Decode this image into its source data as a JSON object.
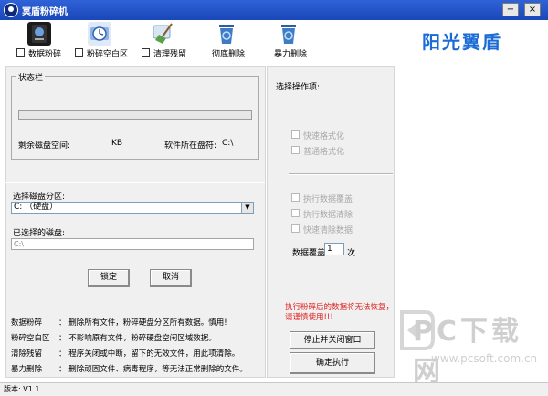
{
  "window": {
    "title": "冥盾粉碎机",
    "minimize": "−",
    "close": "×"
  },
  "toolbar": {
    "items": [
      {
        "label": "数据粉碎",
        "icon": "disk-shredder-icon",
        "color": "#1b1b1b"
      },
      {
        "label": "粉碎空白区",
        "icon": "clock-disk-icon",
        "color": "#4a7fd0"
      },
      {
        "label": "清理残留",
        "icon": "broom-icon",
        "color": "#5aa04a"
      },
      {
        "label": "彻底删除",
        "icon": "recycle-bin-icon",
        "color": "#3f7cc4"
      },
      {
        "label": "暴力删除",
        "icon": "recycle-bin-icon",
        "color": "#3f7cc4"
      }
    ],
    "brand": "阳光翼盾"
  },
  "status": {
    "legend": "状态栏",
    "free_space_label": "剩余磁盘空间:",
    "free_space_unit": "KB",
    "drive_label": "软件所在盘符:",
    "drive_value": "C:\\",
    "progress": 0
  },
  "drive": {
    "select_label": "选择磁盘分区:",
    "selected_option": "C: （硬盘）",
    "chosen_label": "已选择的磁盘:",
    "chosen_value": "C:\\"
  },
  "buttons": {
    "lock": "锁定",
    "cancel": "取消",
    "stop": "停止并关闭窗口",
    "execute": "确定执行"
  },
  "descriptions": [
    {
      "name": "数据粉碎",
      "text": "删除所有文件，粉碎硬盘分区所有数据。慎用!"
    },
    {
      "name": "粉碎空白区",
      "text": "不影响原有文件，粉碎硬盘空闲区域数据。"
    },
    {
      "name": "清除残留",
      "text": "程序关闭或中断，留下的无效文件，用此项清除。"
    },
    {
      "name": "暴力删除",
      "text": "删除顽固文件、病毒程序，等无法正常删除的文件。"
    }
  ],
  "options": {
    "title": "选择操作项:",
    "format": [
      "快速格式化",
      "普通格式化"
    ],
    "wipe": [
      "执行数据覆盖",
      "执行数据清除",
      "快速清除数据"
    ],
    "overwrite_label": "数据覆盖",
    "overwrite_value": "1",
    "overwrite_unit": "次"
  },
  "warning": "执行粉碎后的数据将无法恢复，请谨慎使用!!!",
  "statusbar": {
    "version": "版本:   V1.1"
  },
  "watermark": {
    "text": "PC下载网",
    "url": "www.pcsoft.com.cn"
  }
}
